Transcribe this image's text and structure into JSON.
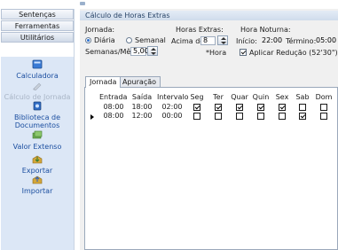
{
  "sidebar": {
    "tabs": [
      {
        "label": "Sentenças"
      },
      {
        "label": "Ferramentas"
      },
      {
        "label": "Utilitários"
      }
    ],
    "items": [
      {
        "label": "Calculadora",
        "icon": "calculator-icon",
        "enabled": true
      },
      {
        "label": "Cálculo de Jornada",
        "icon": "pencil-icon",
        "enabled": false
      },
      {
        "label": "Biblioteca de Documentos",
        "icon": "book-icon",
        "enabled": true
      },
      {
        "label": "Valor Extenso",
        "icon": "money-icon",
        "enabled": true
      },
      {
        "label": "Exportar",
        "icon": "export-icon",
        "enabled": true
      },
      {
        "label": "Importar",
        "icon": "import-icon",
        "enabled": true
      }
    ]
  },
  "window": {
    "title": "Cálculo de Horas Extras"
  },
  "form": {
    "jornada_label": "Jornada:",
    "radio_diaria": "Diária",
    "radio_semanal": "Semanal",
    "selected": "Diária",
    "semanas_label": "Semanas/Mês:",
    "semanas_value": "5,00",
    "horas_extras_label": "Horas Extras:",
    "acima_de_label": "Acima de:",
    "acima_de_value": "8",
    "hora_label": "*Hora",
    "hora_noturna_label": "Hora Noturna:",
    "inicio_label": "Início:",
    "inicio_value": "22:00",
    "termino_label": "Término:",
    "termino_value": "05:00",
    "aplicar_reducao_label": "Aplicar Redução (52'30\")",
    "aplicar_reducao_checked": true
  },
  "tabs": [
    {
      "label": "Jornada",
      "active": true
    },
    {
      "label": "Apuração",
      "active": false
    }
  ],
  "grid": {
    "columns": [
      "Entrada",
      "Saída",
      "Intervalo",
      "Seg",
      "Ter",
      "Quar",
      "Quin",
      "Sex",
      "Sab",
      "Dom"
    ],
    "rows": [
      {
        "entrada": "08:00",
        "saida": "18:00",
        "intervalo": "02:00",
        "days": [
          true,
          true,
          true,
          true,
          true,
          false,
          false
        ],
        "current": false
      },
      {
        "entrada": "08:00",
        "saida": "12:00",
        "intervalo": "00:00",
        "days": [
          false,
          false,
          false,
          false,
          false,
          true,
          false
        ],
        "current": true
      }
    ]
  },
  "colors": {
    "accent": "#1c4fa0",
    "sidebar_panel": "#dce7f6",
    "title_text": "#2a4568"
  }
}
